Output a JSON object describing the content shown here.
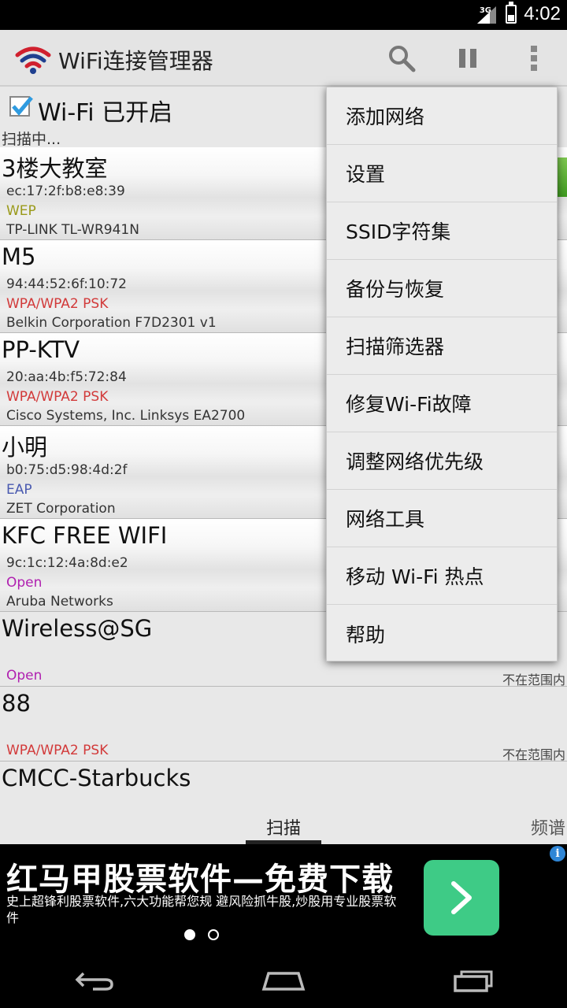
{
  "status_bar": {
    "network_type": "3G",
    "time": "4:02"
  },
  "action_bar": {
    "title": "WiFi连接管理器",
    "icons": [
      "wifi-logo-icon",
      "search-icon",
      "pause-icon",
      "overflow-menu-icon"
    ]
  },
  "wifi_toggle": {
    "label": "Wi-Fi 已开启",
    "checked": true
  },
  "scan_status": "扫描中...",
  "networks": [
    {
      "ssid": "3楼大教室",
      "mac": "ec:17:2f:b8:e8:39",
      "security": "WEP",
      "vendor": "TP-LINK TL-WR941N"
    },
    {
      "ssid": "M5",
      "mac": "94:44:52:6f:10:72",
      "security": "WPA/WPA2 PSK",
      "vendor": "Belkin Corporation F7D2301 v1"
    },
    {
      "ssid": "PP-KTV",
      "mac": "20:aa:4b:f5:72:84",
      "security": "WPA/WPA2 PSK",
      "vendor": "Cisco Systems, Inc. Linksys EA2700"
    },
    {
      "ssid": "小明",
      "mac": "b0:75:d5:98:4d:2f",
      "security": "EAP",
      "vendor": "ZET Corporation"
    },
    {
      "ssid": "KFC FREE WIFI",
      "mac": "9c:1c:12:4a:8d:e2",
      "security": "Open",
      "vendor": "Aruba Networks"
    }
  ],
  "out_of_range_networks": [
    {
      "ssid": "Wireless@SG",
      "security": "Open",
      "status": "不在范围内"
    },
    {
      "ssid": "88",
      "security": "WPA/WPA2 PSK",
      "status": "不在范围内"
    },
    {
      "ssid": "CMCC-Starbucks"
    }
  ],
  "tabs": {
    "scan": "扫描",
    "spectrum": "频谱"
  },
  "menu": {
    "items": [
      "添加网络",
      "设置",
      "SSID字符集",
      "备份与恢复",
      "扫描筛选器",
      "修复Wi-Fi故障",
      "调整网络优先级",
      "网络工具",
      "移动 Wi-Fi 热点",
      "帮助"
    ]
  },
  "ad": {
    "title": "红马甲股票软件—免费下载",
    "description": "史上超锋利股票软件,六大功能帮您规 避风险抓牛股,炒股用专业股票软件",
    "info_icon": "i"
  },
  "colors": {
    "wep": "#9a9a1a",
    "wpa": "#d23a3a",
    "eap": "#4a5ab0",
    "open": "#b020b0",
    "ad_button": "#3ecb86"
  }
}
